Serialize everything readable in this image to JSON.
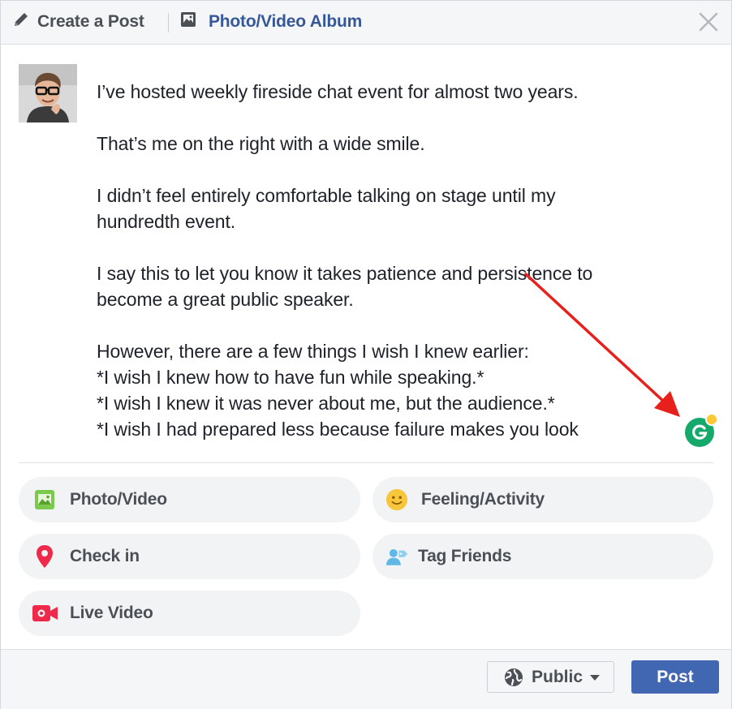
{
  "header": {
    "create_post_label": "Create a Post",
    "album_label": "Photo/Video Album"
  },
  "composer": {
    "paragraphs": [
      [
        "I’ve hosted weekly fireside chat event for almost two years."
      ],
      [
        "That’s me on the right with a wide smile."
      ],
      [
        "I didn’t feel entirely comfortable talking on stage until my",
        "hundredth event."
      ],
      [
        "I say this to let you know it takes patience and persistence to",
        "become a great public speaker."
      ],
      [
        "However, there are a few things I wish I knew earlier:",
        "*I wish I knew how to have fun while speaking.*",
        "*I wish I knew it was never about me, but the audience.*",
        "*I wish I had prepared less because failure makes you look"
      ]
    ]
  },
  "options": {
    "photo_video": "Photo/Video",
    "feeling_activity": "Feeling/Activity",
    "check_in": "Check in",
    "tag_friends": "Tag Friends",
    "live_video": "Live Video"
  },
  "footer": {
    "audience_label": "Public",
    "post_label": "Post"
  },
  "colors": {
    "brand_blue": "#4267b2",
    "link_blue": "#365899",
    "grammarly_green": "#15a96b",
    "annotation_red": "#e8201c"
  },
  "icons": [
    "pencil-icon",
    "album-icon",
    "close-icon",
    "photo-icon",
    "smiley-icon",
    "location-pin-icon",
    "tag-friends-icon",
    "video-camera-icon",
    "globe-icon",
    "caret-down-icon",
    "grammarly-icon",
    "red-arrow"
  ]
}
